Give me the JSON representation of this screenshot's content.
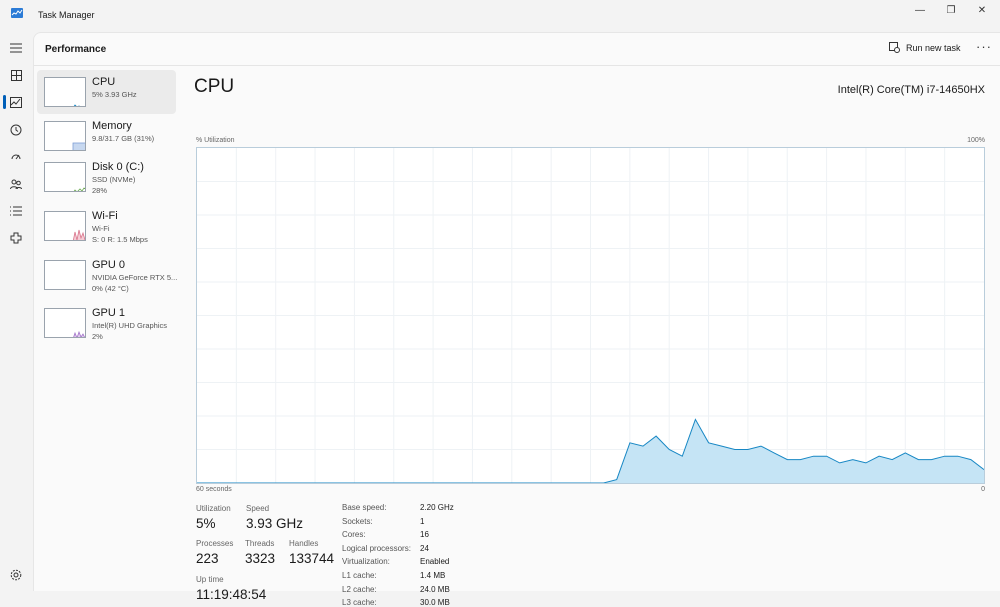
{
  "window": {
    "title": "Task Manager",
    "minimize": "—",
    "restore": "❐",
    "close": "✕"
  },
  "nav": {
    "icons": [
      "hamburger-icon",
      "processes-icon",
      "performance-icon",
      "app-history-icon",
      "startup-apps-icon",
      "users-icon",
      "details-icon",
      "services-icon",
      "settings-icon"
    ]
  },
  "header": {
    "title": "Performance",
    "run_new_task": "Run new task",
    "more": "···"
  },
  "devices": [
    {
      "name": "CPU",
      "sub1": "5%  3.93 GHz",
      "sub2": "",
      "color": "#1787c4"
    },
    {
      "name": "Memory",
      "sub1": "9.8/31.7 GB (31%)",
      "sub2": "",
      "color": "#7e9fd6"
    },
    {
      "name": "Disk 0 (C:)",
      "sub1": "SSD (NVMe)",
      "sub2": "28%",
      "color": "#6aa84f"
    },
    {
      "name": "Wi-Fi",
      "sub1": "Wi-Fi",
      "sub2": "S: 0  R: 1.5 Mbps",
      "color": "#d9738a"
    },
    {
      "name": "GPU 0",
      "sub1": "NVIDIA GeForce RTX 5...",
      "sub2": "0%  (42 °C)",
      "color": "#a070c8"
    },
    {
      "name": "GPU 1",
      "sub1": "Intel(R) UHD Graphics",
      "sub2": "2%",
      "color": "#a070c8"
    }
  ],
  "cpu": {
    "title": "CPU",
    "model": "Intel(R) Core(TM) i7-14650HX",
    "y_axis_label": "% Utilization",
    "y_max_label": "100%",
    "x_left_label": "60 seconds",
    "x_right_label": "0",
    "stats": {
      "utilization_label": "Utilization",
      "utilization": "5%",
      "speed_label": "Speed",
      "speed": "3.93 GHz",
      "processes_label": "Processes",
      "processes": "223",
      "threads_label": "Threads",
      "threads": "3323",
      "handles_label": "Handles",
      "handles": "133744",
      "uptime_label": "Up time",
      "uptime": "11:19:48:54"
    },
    "specs": [
      {
        "label": "Base speed:",
        "value": "2.20 GHz"
      },
      {
        "label": "Sockets:",
        "value": "1"
      },
      {
        "label": "Cores:",
        "value": "16"
      },
      {
        "label": "Logical processors:",
        "value": "24"
      },
      {
        "label": "Virtualization:",
        "value": "Enabled"
      },
      {
        "label": "L1 cache:",
        "value": "1.4 MB"
      },
      {
        "label": "L2 cache:",
        "value": "24.0 MB"
      },
      {
        "label": "L3 cache:",
        "value": "30.0 MB"
      }
    ],
    "graph_color": "#1787c4",
    "graph_fill": "#c5e4f5"
  },
  "chart_data": {
    "type": "area",
    "title": "CPU",
    "ylabel": "% Utilization",
    "xlabel": "60 seconds",
    "ylim": [
      0,
      100
    ],
    "xlim": [
      60,
      0
    ],
    "grid": true,
    "x": [
      60,
      30,
      29,
      28,
      27,
      26,
      25,
      24,
      23,
      22,
      21,
      20,
      19,
      18,
      17,
      16,
      15,
      14,
      13,
      12,
      11,
      10,
      9,
      8,
      7,
      6,
      5,
      4,
      3,
      2,
      1,
      0
    ],
    "values": [
      0,
      0,
      0,
      1,
      12,
      11,
      14,
      10,
      8,
      19,
      12,
      11,
      10,
      10,
      11,
      9,
      7,
      7,
      8,
      8,
      6,
      7,
      6,
      8,
      7,
      9,
      7,
      7,
      8,
      8,
      7,
      4
    ]
  }
}
